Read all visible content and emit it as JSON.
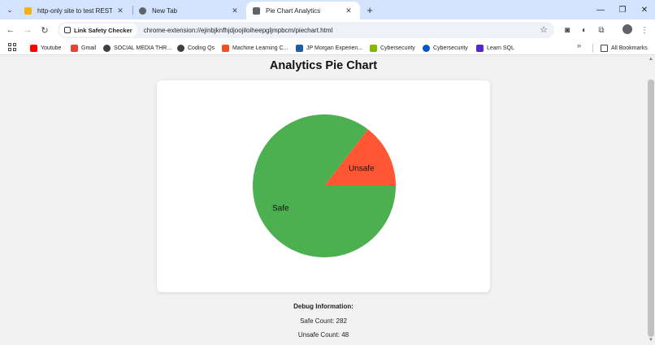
{
  "browser": {
    "tabs": [
      {
        "title": "http-only site to test REST requ",
        "active": false,
        "favicon_color": "#f4b400"
      },
      {
        "title": "New Tab",
        "active": false,
        "favicon_color": "#5f6368"
      },
      {
        "title": "Pie Chart Analytics",
        "active": true,
        "favicon_color": "#5f6368"
      }
    ],
    "new_tab_label": "+",
    "window_controls": {
      "minimize": "—",
      "restore": "❐",
      "close": "✕"
    },
    "address_chip": "Link Safety Checker",
    "url": "chrome-extension://ejinbjknfhjdjoojiloiheepgljmpbcm/piechart.html",
    "bookmarks": [
      {
        "label": "Youtube",
        "icon": "youtube-icon",
        "color": "#ff0000"
      },
      {
        "label": "Gmail",
        "icon": "gmail-icon",
        "color": "#ea4335"
      },
      {
        "label": "SOCIAL MEDIA THR...",
        "icon": "globe-icon",
        "color": "#3c4043"
      },
      {
        "label": "Coding Qs",
        "icon": "globe-icon",
        "color": "#3c4043"
      },
      {
        "label": "Machine Learning C...",
        "icon": "microsoft-icon",
        "color": "#f25022"
      },
      {
        "label": "JP Morgan Experien...",
        "icon": "jpmorgan-icon",
        "color": "#1a5ca8"
      },
      {
        "label": "Cybersecurity",
        "icon": "microsoft-icon",
        "color": "#7fba00"
      },
      {
        "label": "Cybersecurity",
        "icon": "coursera-icon",
        "color": "#0056d2"
      },
      {
        "label": "Learn SQL",
        "icon": "udemy-icon",
        "color": "#5624d0"
      }
    ],
    "more_bookmarks": "»",
    "all_bookmarks": "All Bookmarks"
  },
  "page": {
    "title": "Analytics Pie Chart",
    "debug_title": "Debug Information:",
    "safe_count_text": "Safe Count: 282",
    "unsafe_count_text": "Unsafe Count: 48"
  },
  "chart_data": {
    "type": "pie",
    "labels": [
      "Safe",
      "Unsafe"
    ],
    "values": [
      282,
      48
    ],
    "colors": [
      "#4caf50",
      "#ff5733"
    ]
  }
}
